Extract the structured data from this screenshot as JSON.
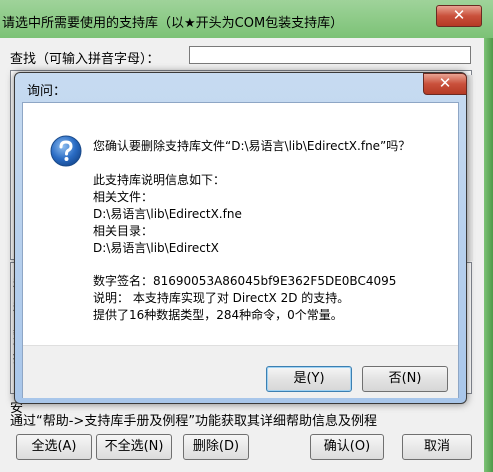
{
  "window": {
    "title": "请选中所需要使用的支持库（以★开头为COM包装支持库）",
    "close_glyph": "✕"
  },
  "search": {
    "label": "查找（可输入拼音字母）："
  },
  "left_peek": {
    "list_glyphs": [
      "D",
      "称",
      "D",
      "称",
      "D",
      "数",
      "说",
      "拱"
    ]
  },
  "bottom_peek": {
    "line1": "安",
    "line2": "通过“帮助->支持库手册及例程”功能获取其详细帮助信息及例程"
  },
  "bottom_buttons": {
    "select_all": "全选(A)",
    "select_none": "不全选(N)",
    "delete": "删除(D)",
    "ok": "确认(O)",
    "cancel": "取消"
  },
  "dialog": {
    "title": "询问：",
    "close_glyph": "✕",
    "icon": "question-icon",
    "lines": {
      "question": "您确认要删除支持库文件“D:\\易语言\\lib\\EdirectX.fne”吗？",
      "info_header": "此支持库说明信息如下：",
      "file_label": "相关文件：",
      "file_path": "D:\\易语言\\lib\\EdirectX.fne",
      "dir_label": "相关目录：",
      "dir_path": "D:\\易语言\\lib\\EdirectX",
      "signature": "数字签名：81690053A86045bf9E362F5DE0BC4095",
      "description": "说明：   本支持库实现了对 DirectX 2D 的支持。",
      "stats": "提供了16种数据类型，284种命令，0个常量。"
    },
    "yes_label": "是(Y)",
    "no_label": "否(N)"
  },
  "colors": {
    "window_frame": "#7cc276",
    "dialog_frame": "#b4cdec",
    "close_button": "#c9503b"
  }
}
